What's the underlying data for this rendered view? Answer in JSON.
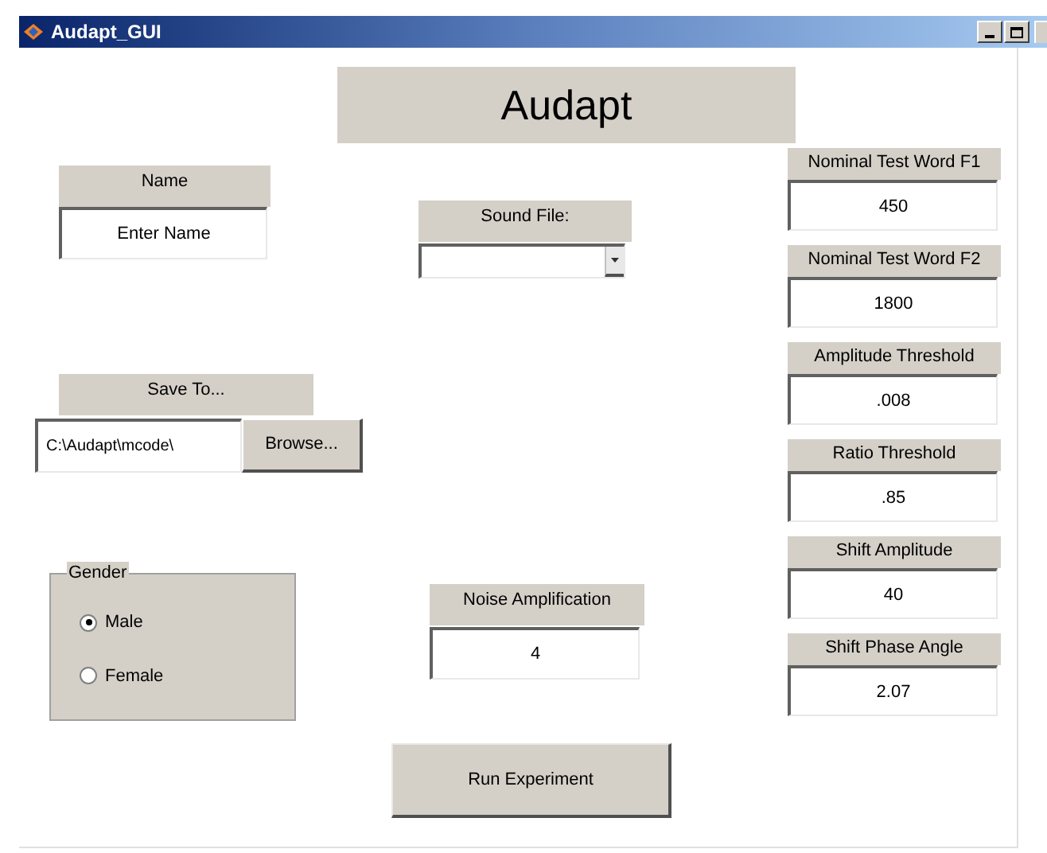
{
  "window": {
    "title": "Audapt_GUI"
  },
  "heading": "Audapt",
  "name": {
    "label": "Name",
    "value": "Enter Name"
  },
  "save_to": {
    "label": "Save To...",
    "value": "C:\\Audapt\\mcode\\",
    "button": "Browse..."
  },
  "gender": {
    "title": "Gender",
    "options": [
      {
        "label": "Male",
        "selected": true
      },
      {
        "label": "Female",
        "selected": false
      }
    ]
  },
  "sound_file": {
    "label": "Sound File:"
  },
  "noise_amplification": {
    "label": "Noise Amplification",
    "value": "4"
  },
  "run_button": "Run Experiment",
  "parameters": [
    {
      "label": "Nominal Test Word F1",
      "value": "450"
    },
    {
      "label": "Nominal Test Word F2",
      "value": "1800"
    },
    {
      "label": "Amplitude Threshold",
      "value": ".008"
    },
    {
      "label": "Ratio Threshold",
      "value": ".85"
    },
    {
      "label": "Shift Amplitude",
      "value": "40"
    },
    {
      "label": "Shift Phase Angle",
      "value": "2.07"
    }
  ]
}
